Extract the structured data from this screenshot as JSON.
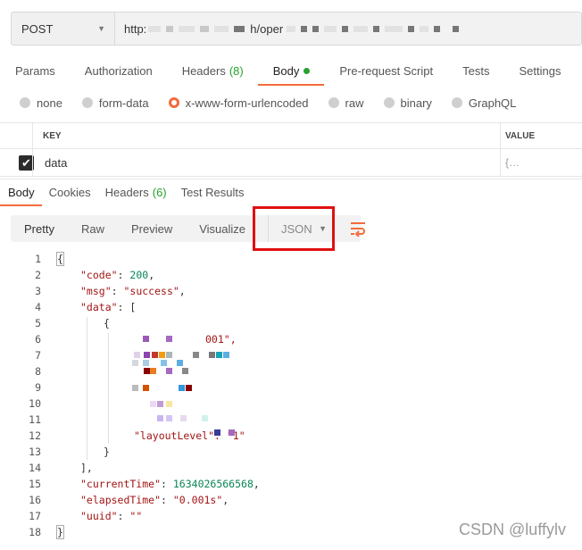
{
  "request": {
    "method": "POST",
    "url_prefix": "http:",
    "url_visible_part": "h/oper"
  },
  "request_tabs": [
    {
      "label": "Params"
    },
    {
      "label": "Authorization"
    },
    {
      "label": "Headers",
      "count": "(8)"
    },
    {
      "label": "Body",
      "active": true
    },
    {
      "label": "Pre-request Script"
    },
    {
      "label": "Tests"
    },
    {
      "label": "Settings"
    }
  ],
  "body_modes": [
    {
      "label": "none"
    },
    {
      "label": "form-data"
    },
    {
      "label": "x-www-form-urlencoded",
      "selected": true
    },
    {
      "label": "raw"
    },
    {
      "label": "binary"
    },
    {
      "label": "GraphQL"
    }
  ],
  "params_table": {
    "headers": {
      "key": "KEY",
      "value": "VALUE"
    },
    "rows": [
      {
        "checked": true,
        "key": "data",
        "value": "{…"
      }
    ]
  },
  "response_tabs": [
    {
      "label": "Body",
      "active": true
    },
    {
      "label": "Cookies"
    },
    {
      "label": "Headers",
      "count": "(6)"
    },
    {
      "label": "Test Results"
    }
  ],
  "view_modes": [
    "Pretty",
    "Raw",
    "Preview",
    "Visualize"
  ],
  "format_select": "JSON",
  "response_body": {
    "line_numbers": [
      "1",
      "2",
      "3",
      "4",
      "5",
      "6",
      "7",
      "8",
      "9",
      "10",
      "11",
      "12",
      "13",
      "14",
      "15",
      "16",
      "17",
      "18"
    ],
    "open_brace": "{",
    "close_brace": "}",
    "code_key": "\"code\"",
    "code_value": "200",
    "msg_key": "\"msg\"",
    "msg_value": "\"success\"",
    "data_key": "\"data\"",
    "data_open": "[",
    "item_open": "{",
    "line6_tail": "001\",",
    "line12_text": "\"layoutLevel\": \"1\"",
    "item_close": "}",
    "data_close": "],",
    "currentTime_key": "\"currentTime\"",
    "currentTime_value": "1634026566568",
    "elapsedTime_key": "\"elapsedTime\"",
    "elapsedTime_value": "\"0.001s\"",
    "uuid_key": "\"uuid\"",
    "uuid_value": "\"\""
  },
  "colors": {
    "accent": "#f26b3a",
    "count_green": "#27a12e",
    "highlight_red": "#e01010",
    "json_key": "#a31515",
    "json_number": "#098658"
  },
  "watermark": "CSDN @luffylv"
}
